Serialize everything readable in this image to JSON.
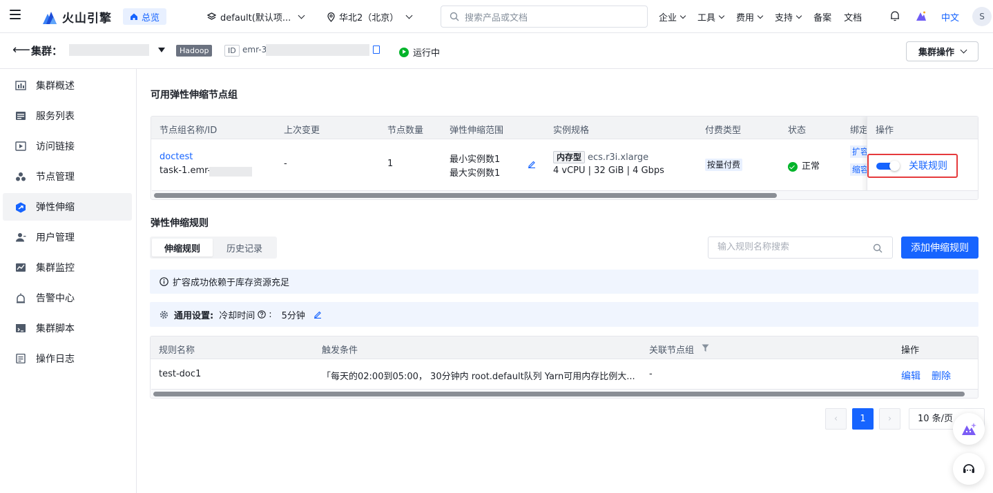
{
  "topbar": {
    "brand": "火山引擎",
    "overview": "总览",
    "project": "default(默认项...",
    "region": "华北2（北京）",
    "search_placeholder": "搜索产品或文档",
    "nav": [
      "企业",
      "工具",
      "费用",
      "支持",
      "备案",
      "文档"
    ],
    "lang": "中文",
    "user_initial": "S"
  },
  "cluster_bar": {
    "label": "集群：",
    "type_tag": "Hadoop",
    "id_label": "ID",
    "id_prefix": "emr-3",
    "status": "运行中",
    "ops_button": "集群操作"
  },
  "sidebar": {
    "items": [
      {
        "label": "集群概述",
        "icon": "chart-icon"
      },
      {
        "label": "服务列表",
        "icon": "list-icon"
      },
      {
        "label": "访问链接",
        "icon": "play-icon"
      },
      {
        "label": "节点管理",
        "icon": "nodes-icon"
      },
      {
        "label": "弹性伸缩",
        "icon": "autoscale-icon",
        "active": true
      },
      {
        "label": "用户管理",
        "icon": "user-icon"
      },
      {
        "label": "集群监控",
        "icon": "monitor-icon"
      },
      {
        "label": "告警中心",
        "icon": "alarm-icon"
      },
      {
        "label": "集群脚本",
        "icon": "script-icon"
      },
      {
        "label": "操作日志",
        "icon": "log-icon"
      }
    ]
  },
  "node_groups": {
    "title": "可用弹性伸缩节点组",
    "columns": [
      "节点组名称/ID",
      "上次变更",
      "节点数量",
      "弹性伸缩范围",
      "实例规格",
      "付费类型",
      "状态",
      "绑定",
      "操作"
    ],
    "row": {
      "name": "doctest",
      "id": "task-1.emr-",
      "last_change": "-",
      "count": "1",
      "range_min": "最小实例数1",
      "range_max": "最大实例数1",
      "spec_tag": "内存型",
      "spec_name": "ecs.r3i.xlarge",
      "spec_detail": "4 vCPU | 32 GiB | 4 Gbps",
      "pay": "按量付费",
      "status": "正常",
      "bind1": "扩容",
      "bind2": "缩容",
      "action": "关联规则"
    }
  },
  "rules": {
    "title": "弹性伸缩规则",
    "tabs": [
      "伸缩规则",
      "历史记录"
    ],
    "search_placeholder": "输入规则名称搜索",
    "add_button": "添加伸缩规则",
    "info": "扩容成功依赖于库存资源充足",
    "settings_label": "通用设置:",
    "cooldown_label": "冷却时间",
    "cooldown_value": "5分钟",
    "columns": [
      "规则名称",
      "触发条件",
      "关联节点组",
      "操作"
    ],
    "row": {
      "name": "test-doc1",
      "condition": "「每天的02:00到05:00， 30分钟内 root.default队列 Yarn可用内存比例大...",
      "group": "-",
      "edit": "编辑",
      "delete": "删除"
    },
    "pager": {
      "current": "1",
      "size": "10 条/页"
    }
  },
  "colors": {
    "primary": "#1664ff",
    "success": "#00b42a",
    "highlight": "#e5393b"
  }
}
